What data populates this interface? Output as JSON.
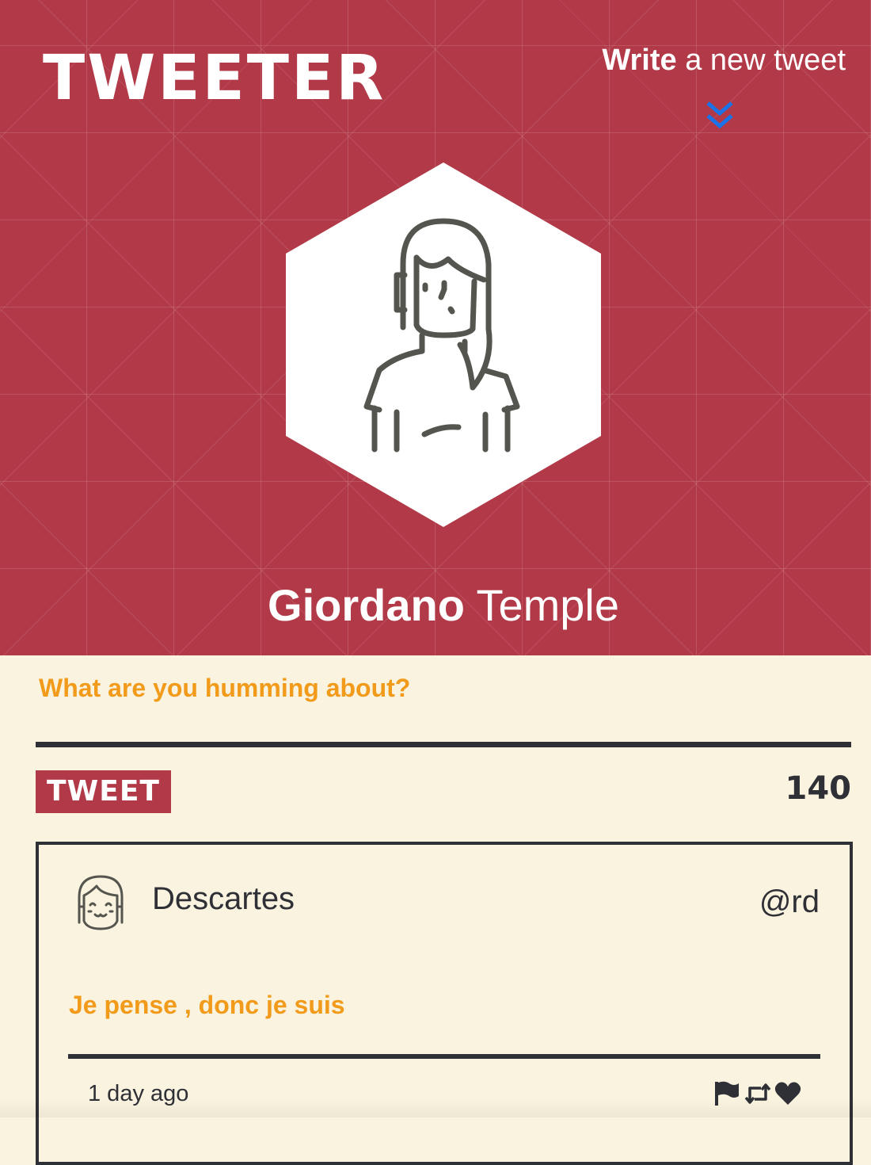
{
  "header": {
    "logo": "TWEETER",
    "compose_link_bold": "Write",
    "compose_link_rest": " a new tweet",
    "profile_first_name": "Giordano",
    "profile_last_name": "Temple"
  },
  "compose": {
    "placeholder": "What are you humming about?",
    "submit_label": "TWEET",
    "char_count": "140"
  },
  "tweets": [
    {
      "user": "Descartes",
      "handle": "@rd",
      "text": "Je pense , donc je suis",
      "time": "1 day ago"
    }
  ],
  "icons": {
    "compose_chevron": "double-chevron-down-icon",
    "profile_avatar": "user-avatar",
    "flag": "flag-icon",
    "retweet": "retweet-icon",
    "like": "heart-icon"
  },
  "colors": {
    "header_bg": "#b23a48",
    "page_bg": "#f9f3df",
    "accent_orange": "#f29a1a",
    "dark": "#2f2f36",
    "chevron": "#1a73e8"
  }
}
